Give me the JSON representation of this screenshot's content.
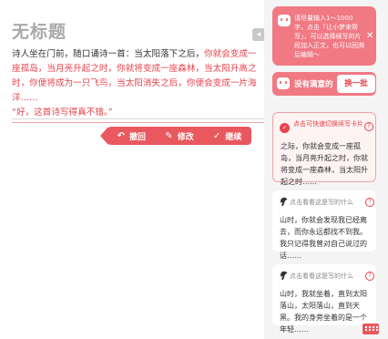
{
  "editor": {
    "title": "无标题",
    "lines": {
      "l1a": "诗人坐在门前，随口诵诗一首：当太阳落下之后，",
      "l1b": "你就会变成一座孤岛，",
      "l2": "当月亮升起之时，你就将变成一座森林，当太阳升高之时，你便将成为一只飞鸟，当太阳消失之后，你便会变成一片海洋……",
      "quote": "“好，这首诗写得真不错。”"
    },
    "actions": {
      "undo": "撤回",
      "edit": "修改",
      "continue": "继续"
    }
  },
  "panel": {
    "promo_text": "请尽量输入1～1000字，点击「让小梦来帮写」，可以选择续写的片段加入正文，也可以回溯后编辑～",
    "refresh_label": "没有满意的",
    "refresh_button": "换一批",
    "cards": [
      {
        "head": "点击可快速切换续写卡片",
        "text": "之际，你就会变成一座孤岛，当月亮升起之时，你就将变成一座森林，当太阳升起之时……"
      },
      {
        "head": "点击看看这是写的什么",
        "text": "山时，你就会发现我已经离去，而你永远都找不到我。我只记得我曾对自己说过的话……"
      },
      {
        "head": "点击看看这是写的什么",
        "text": "山时，我就坐着，直到太阳落山，太阳落山，直到天黑。我的身旁坐着的是一个年轻……"
      }
    ]
  },
  "colors": {
    "accent": "#e9585f",
    "highlight": "#e8424c",
    "card_bg": "#f07984"
  }
}
